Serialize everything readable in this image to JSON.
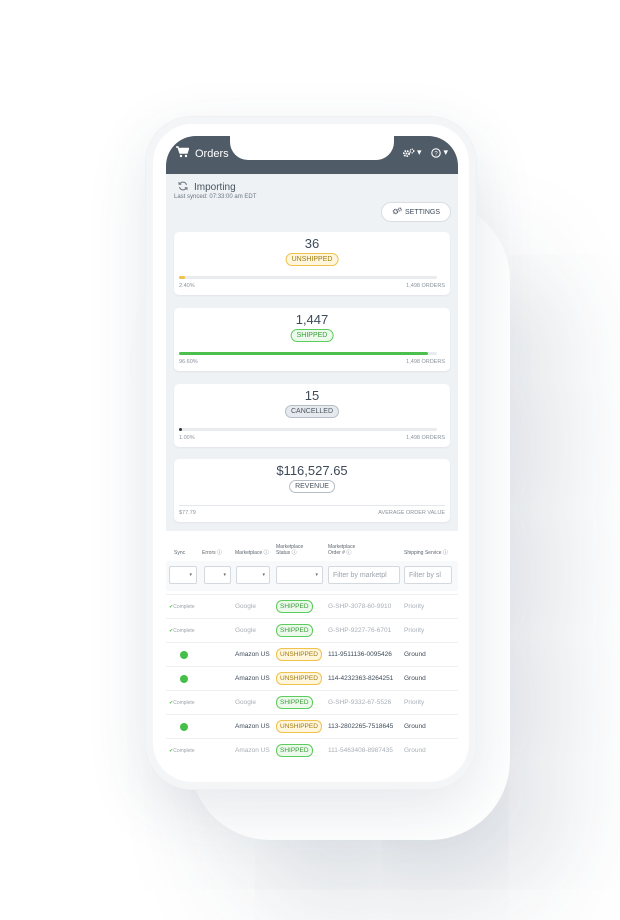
{
  "header": {
    "title": "Orders",
    "settings_caret": "▾",
    "help_caret": "▾"
  },
  "status": {
    "importing": "Importing",
    "last_synced": "Last synced: 07:33:00 am EDT"
  },
  "settings_button": "SETTINGS",
  "cards": [
    {
      "value": "36",
      "badge": "UNSHIPPED",
      "percent_label": "2.40%",
      "percent": 2.4,
      "total": "1,498 ORDERS",
      "color": "#f0c14b"
    },
    {
      "value": "1,447",
      "badge": "SHIPPED",
      "percent_label": "96.60%",
      "percent": 96.6,
      "total": "1,498 ORDERS",
      "color": "#4cc04c"
    },
    {
      "value": "15",
      "badge": "CANCELLED",
      "percent_label": "1.00%",
      "percent": 1.0,
      "total": "1,498 ORDERS",
      "color": "#333333"
    },
    {
      "value": "$116,527.65",
      "badge": "REVENUE",
      "left_label": "$77.79",
      "right_label": "AVERAGE ORDER VALUE"
    }
  ],
  "table": {
    "headers": {
      "sync": "Sync",
      "errors": "Errors",
      "marketplace": "Marketplace",
      "mp_status": "Marketplace Status",
      "mp_order": "Marketplace Order #",
      "shipping": "Shipping Service"
    },
    "filters": {
      "marketplace_order_placeholder": "Filter by marketpl",
      "shipping_placeholder": "Filter by sl"
    },
    "rows": [
      {
        "sync": "Complete",
        "marketplace": "Google",
        "status": "SHIPPED",
        "order": "G-SHP-3078-60-9910",
        "service": "Priority"
      },
      {
        "sync": "Complete",
        "marketplace": "Google",
        "status": "SHIPPED",
        "order": "G-SHP-9227-76-6701",
        "service": "Priority"
      },
      {
        "sync": "dot",
        "marketplace": "Amazon US",
        "status": "UNSHIPPED",
        "order": "111-9511136-0095426",
        "service": "Ground"
      },
      {
        "sync": "dot",
        "marketplace": "Amazon US",
        "status": "UNSHIPPED",
        "order": "114-4232363-8264251",
        "service": "Ground"
      },
      {
        "sync": "Complete",
        "marketplace": "Google",
        "status": "SHIPPED",
        "order": "G-SHP-9332-67-5526",
        "service": "Priority"
      },
      {
        "sync": "dot",
        "marketplace": "Amazon US",
        "status": "UNSHIPPED",
        "order": "113-2802265-7518645",
        "service": "Ground"
      },
      {
        "sync": "Complete",
        "marketplace": "Amazon US",
        "status": "SHIPPED",
        "order": "111-5463408-8987435",
        "service": "Ground"
      }
    ]
  }
}
